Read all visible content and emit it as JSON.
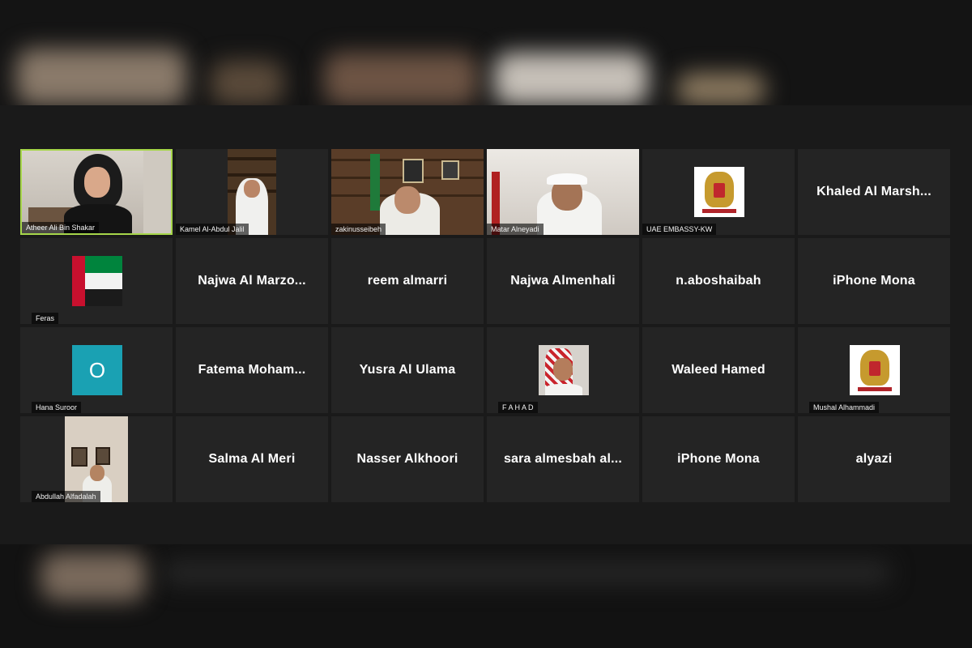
{
  "participants": [
    {
      "name": "Atheer Ali Bin Shakar"
    },
    {
      "name": "Kamel Al-Abdul Jalil"
    },
    {
      "name": "zakinusseibeh"
    },
    {
      "name": "Matar Alneyadi"
    },
    {
      "name": "UAE EMBASSY-KW"
    },
    {
      "name": "Khaled Al Marsh..."
    },
    {
      "name": "Feras"
    },
    {
      "name": "Najwa Al Marzo..."
    },
    {
      "name": "reem almarri"
    },
    {
      "name": "Najwa Almenhali"
    },
    {
      "name": "n.aboshaibah"
    },
    {
      "name": "iPhone Mona"
    },
    {
      "name": "Hana Suroor",
      "avatar_letter": "O"
    },
    {
      "name": "Fatema Moham..."
    },
    {
      "name": "Yusra Al Ulama"
    },
    {
      "name": "F A H A D"
    },
    {
      "name": "Waleed Hamed"
    },
    {
      "name": "Mushal Alhammadi"
    },
    {
      "name": "Abdullah Alfadalah"
    },
    {
      "name": "Salma Al Meri"
    },
    {
      "name": "Nasser Alkhoori"
    },
    {
      "name": "sara almesbah al..."
    },
    {
      "name": "iPhone Mona"
    },
    {
      "name": "alyazi"
    }
  ],
  "colors": {
    "active_speaker": "#a6d64a",
    "tile_bg": "#242424",
    "avatar_bg": "#1aa1b3"
  }
}
